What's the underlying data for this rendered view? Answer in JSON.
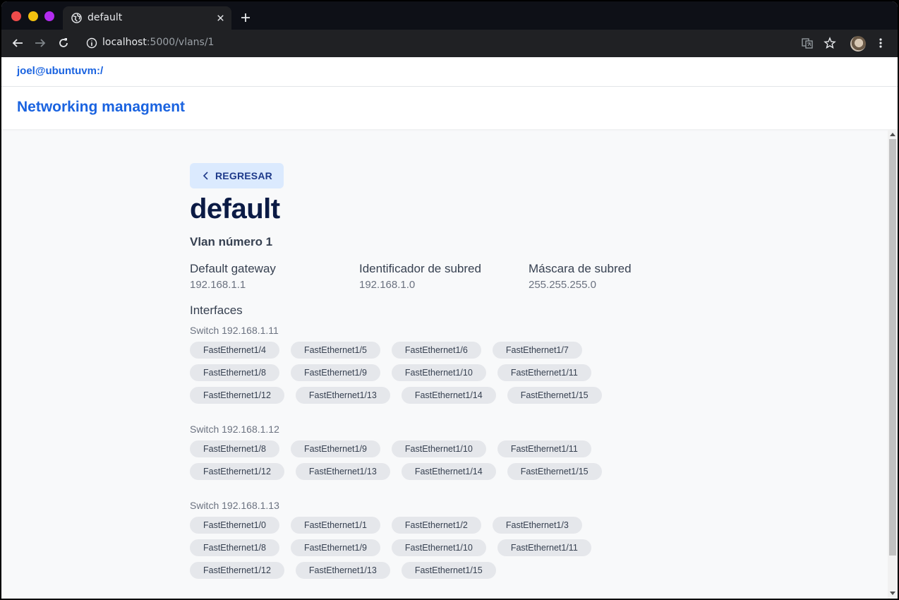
{
  "browser": {
    "tab_title": "default",
    "url_host": "localhost",
    "url_rest": ":5000/vlans/1",
    "icons": [
      "globe-icon",
      "close-icon",
      "plus-icon",
      "back-arrow-icon",
      "forward-arrow-icon",
      "reload-icon",
      "info-icon",
      "translate-icon",
      "star-icon",
      "kebab-menu-icon"
    ]
  },
  "topbar": {
    "user": "joel@ubuntuvm:/"
  },
  "header": {
    "brand": "Networking managment"
  },
  "vlan": {
    "back_label": "REGRESAR",
    "name": "default",
    "number_label": "Vlan número 1",
    "props": [
      {
        "label": "Default gateway",
        "value": "192.168.1.1"
      },
      {
        "label": "Identificador de subred",
        "value": "192.168.1.0"
      },
      {
        "label": "Máscara de subred",
        "value": "255.255.255.0"
      }
    ],
    "interfaces_title": "Interfaces",
    "switches": [
      {
        "label": "Switch 192.168.1.11",
        "interfaces": [
          "FastEthernet1/4",
          "FastEthernet1/5",
          "FastEthernet1/6",
          "FastEthernet1/7",
          "FastEthernet1/8",
          "FastEthernet1/9",
          "FastEthernet1/10",
          "FastEthernet1/11",
          "FastEthernet1/12",
          "FastEthernet1/13",
          "FastEthernet1/14",
          "FastEthernet1/15"
        ]
      },
      {
        "label": "Switch 192.168.1.12",
        "interfaces": [
          "FastEthernet1/8",
          "FastEthernet1/9",
          "FastEthernet1/10",
          "FastEthernet1/11",
          "FastEthernet1/12",
          "FastEthernet1/13",
          "FastEthernet1/14",
          "FastEthernet1/15"
        ]
      },
      {
        "label": "Switch 192.168.1.13",
        "interfaces": [
          "FastEthernet1/0",
          "FastEthernet1/1",
          "FastEthernet1/2",
          "FastEthernet1/3",
          "FastEthernet1/8",
          "FastEthernet1/9",
          "FastEthernet1/10",
          "FastEthernet1/11",
          "FastEthernet1/12",
          "FastEthernet1/13",
          "FastEthernet1/15"
        ]
      }
    ]
  },
  "colors": {
    "brand": "#1a63e0",
    "title": "#0b1b45",
    "chip_bg": "#e5e7eb",
    "back_bg": "#dbeafe",
    "back_text": "#1e3a8a"
  }
}
